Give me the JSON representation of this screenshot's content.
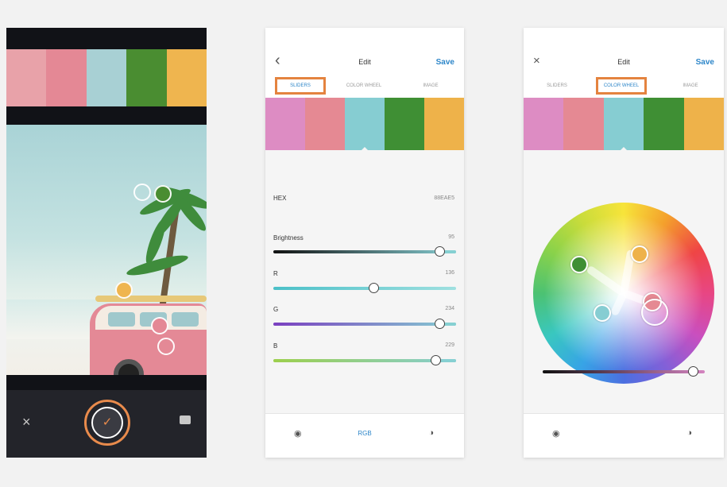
{
  "palette": {
    "phone1": [
      "#e8a2a9",
      "#e48895",
      "#a8d0d4",
      "#4a8d31",
      "#efb54f"
    ],
    "edit": [
      "#dd8cc3",
      "#e58993",
      "#86cdd2",
      "#3f8f34",
      "#eeb24a"
    ]
  },
  "edit_screen": {
    "title": "Edit",
    "save_label": "Save",
    "tabs": [
      "SLIDERS",
      "COLOR WHEEL",
      "IMAGE"
    ]
  },
  "sliders": {
    "hex_label": "HEX",
    "hex_value": "88EAE5",
    "rows": [
      {
        "label": "Brightness",
        "value": "95",
        "level": 0.91
      },
      {
        "label": "R",
        "value": "136",
        "level": 0.55
      },
      {
        "label": "G",
        "value": "234",
        "level": 0.91
      },
      {
        "label": "B",
        "value": "229",
        "level": 0.89
      }
    ]
  },
  "bottom_bar": {
    "mode_label": "RGB"
  },
  "color_wheel": {
    "brightness_level": 0.93
  },
  "colors": {
    "accent": "#2d86c9",
    "highlight": "#e4833f",
    "capture_ring": "#e98b4c"
  },
  "icons": {
    "close": "×",
    "back": "‹",
    "confirm": "✓",
    "gallery": "image-icon",
    "color_mode_1": "color-harmony-icon",
    "color_mode_2": "palette-icon"
  }
}
